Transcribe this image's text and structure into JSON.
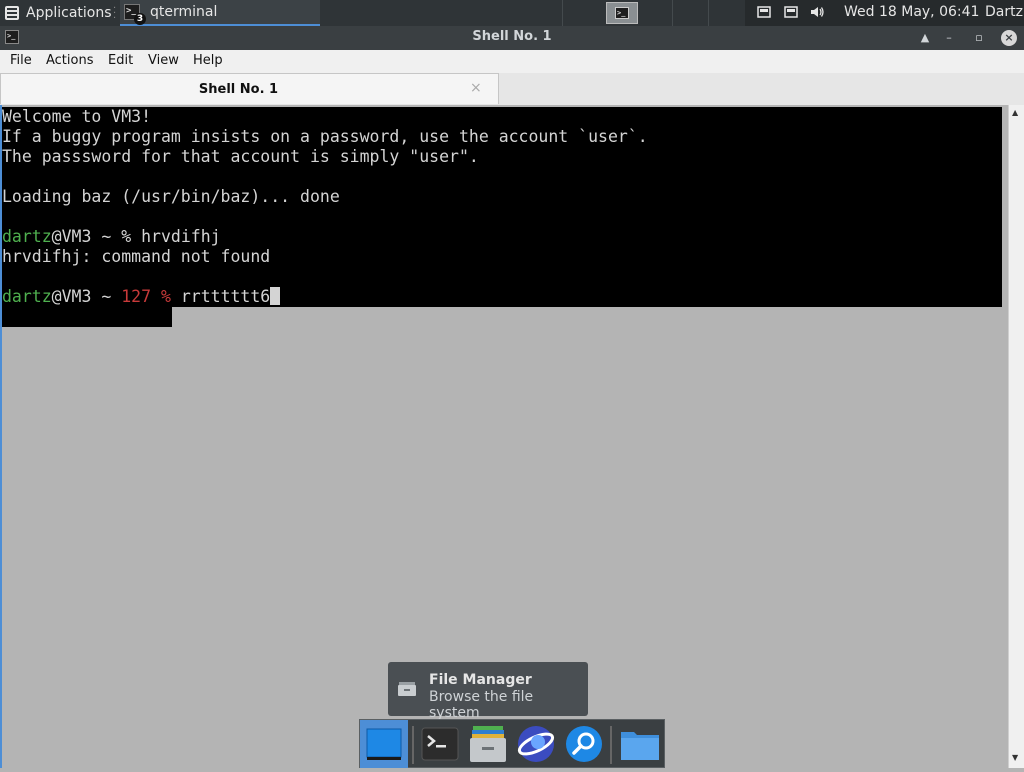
{
  "top_panel": {
    "applications_label": "Applications",
    "task_label": "qterminal",
    "task_badge": "3",
    "clock": "Wed 18 May, 06:41",
    "user": "Dartz"
  },
  "window": {
    "title": "Shell No. 1",
    "menu": [
      "File",
      "Actions",
      "Edit",
      "View",
      "Help"
    ],
    "tab_label": "Shell No. 1",
    "tab_close": "×"
  },
  "terminal": {
    "line1": "Welcome to VM3!",
    "line2": "If a buggy program insists on a password, use the account `user`.",
    "line3": "The passsword for that account is simply \"user\".",
    "line5": "Loading baz (/usr/bin/baz)... done",
    "prompt_user": "dartz",
    "prompt_host": "@VM3 ~ ",
    "prompt_sym": "% ",
    "cmd1": "hrvdifhj",
    "error1": "hrvdifhj: command not found",
    "exit_code": "127 % ",
    "current_input": "rrtttttt6"
  },
  "tooltip": {
    "title": "File Manager",
    "description": "Browse the file system"
  },
  "dock": {
    "items": [
      "desktop-icon",
      "terminal-icon",
      "file-manager-icon",
      "browser-icon",
      "search-icon",
      "folder-icon"
    ]
  },
  "colors": {
    "accent": "#4d8ed6",
    "prompt_green": "#4fb04f",
    "error_red": "#c83a3a"
  }
}
